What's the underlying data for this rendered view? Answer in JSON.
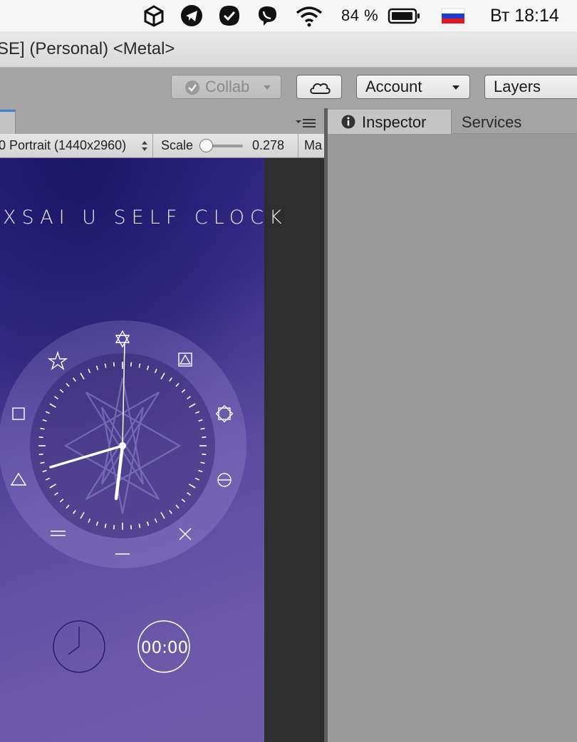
{
  "menubar": {
    "battery_text": "84 %",
    "clock_text": "Вт 18:14",
    "icons": [
      "unity-icon",
      "telegram-icon",
      "checkmark-icon",
      "viber-icon",
      "wifi-icon",
      "battery-icon",
      "russian-flag-icon"
    ]
  },
  "window": {
    "title": "SE] (Personal) <Metal>"
  },
  "toolbar": {
    "collab_label": "Collab",
    "account_label": "Account",
    "layers_label": "Layers"
  },
  "game_view": {
    "resolution_label": "0 Portrait (1440x2960)",
    "scale_label": "Scale",
    "scale_value": "0.278",
    "maximize_label": "Ma"
  },
  "app": {
    "title": "XSAI U SELF CLOCK",
    "timer_label": "00:00",
    "accent_color": "#ffffff"
  },
  "inspector": {
    "tab_inspector": "Inspector",
    "tab_services": "Services"
  }
}
